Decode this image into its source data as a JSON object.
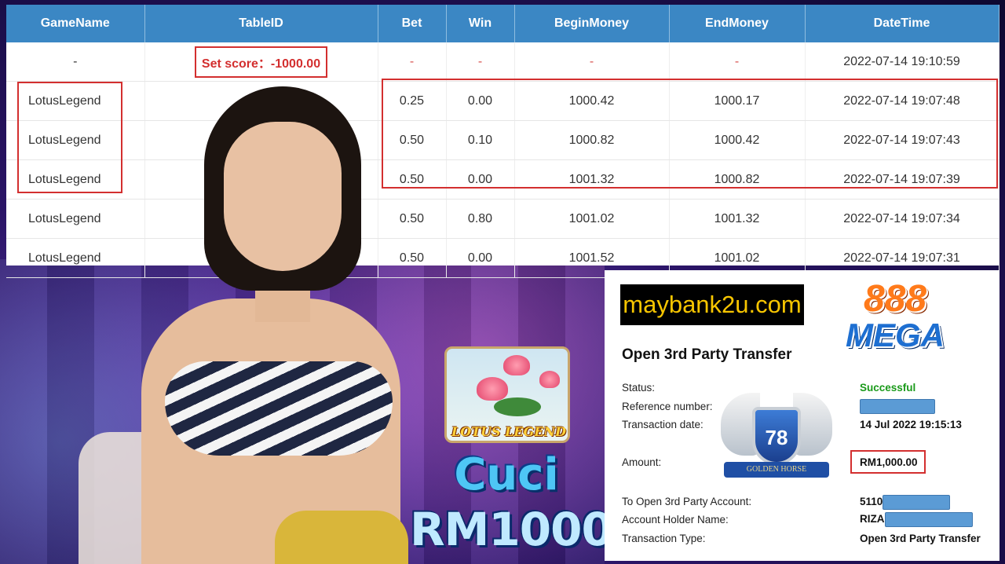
{
  "table": {
    "headers": [
      "GameName",
      "TableID",
      "Bet",
      "Win",
      "BeginMoney",
      "EndMoney",
      "DateTime"
    ],
    "set_score_row": {
      "game_name": "-",
      "set_score_label": "Set score：-1000.00",
      "bet": "-",
      "win": "-",
      "begin_money": "-",
      "end_money": "-",
      "datetime": "2022-07-14 19:10:59"
    },
    "rows": [
      {
        "game_name": "LotusLegend",
        "bet": "0.25",
        "win": "0.00",
        "begin_money": "1000.42",
        "end_money": "1000.17",
        "datetime": "2022-07-14 19:07:48"
      },
      {
        "game_name": "LotusLegend",
        "bet": "0.50",
        "win": "0.10",
        "begin_money": "1000.82",
        "end_money": "1000.42",
        "datetime": "2022-07-14 19:07:43"
      },
      {
        "game_name": "LotusLegend",
        "bet": "0.50",
        "win": "0.00",
        "begin_money": "1001.32",
        "end_money": "1000.82",
        "datetime": "2022-07-14 19:07:39"
      },
      {
        "game_name": "LotusLegend",
        "bet": "0.50",
        "win": "0.80",
        "begin_money": "1001.02",
        "end_money": "1001.32",
        "datetime": "2022-07-14 19:07:34"
      },
      {
        "game_name": "LotusLegend",
        "bet": "0.50",
        "win": "0.00",
        "begin_money": "1001.52",
        "end_money": "1001.02",
        "datetime": "2022-07-14 19:07:31"
      }
    ]
  },
  "promo": {
    "game_icon_title": "LOTUS LEGEND",
    "cuci": "Cuci",
    "amount": "RM1000"
  },
  "receipt": {
    "bank_logo": "maybank2u.com",
    "brand_888": "888",
    "brand_mega": "MEGA",
    "title": "Open 3rd Party Transfer",
    "status_label": "Status:",
    "status_value": "Successful",
    "reference_label": "Reference number:",
    "date_label": "Transaction date:",
    "date_value": "14 Jul 2022 19:15:13",
    "amount_label": "Amount:",
    "amount_value": "RM1,000.00",
    "account_label": "To Open 3rd Party Account:",
    "account_value": "5110",
    "holder_label": "Account Holder Name:",
    "holder_value": "RIZA",
    "type_label": "Transaction Type:",
    "type_value": "Open 3rd Party Transfer",
    "badge_number": "78",
    "badge_ribbon": "GOLDEN HORSE"
  },
  "colors": {
    "header_blue": "#3b87c4",
    "highlight_red": "#d32f2f",
    "success_green": "#1a9a1a",
    "redaction_blue": "#5b9bd5"
  }
}
